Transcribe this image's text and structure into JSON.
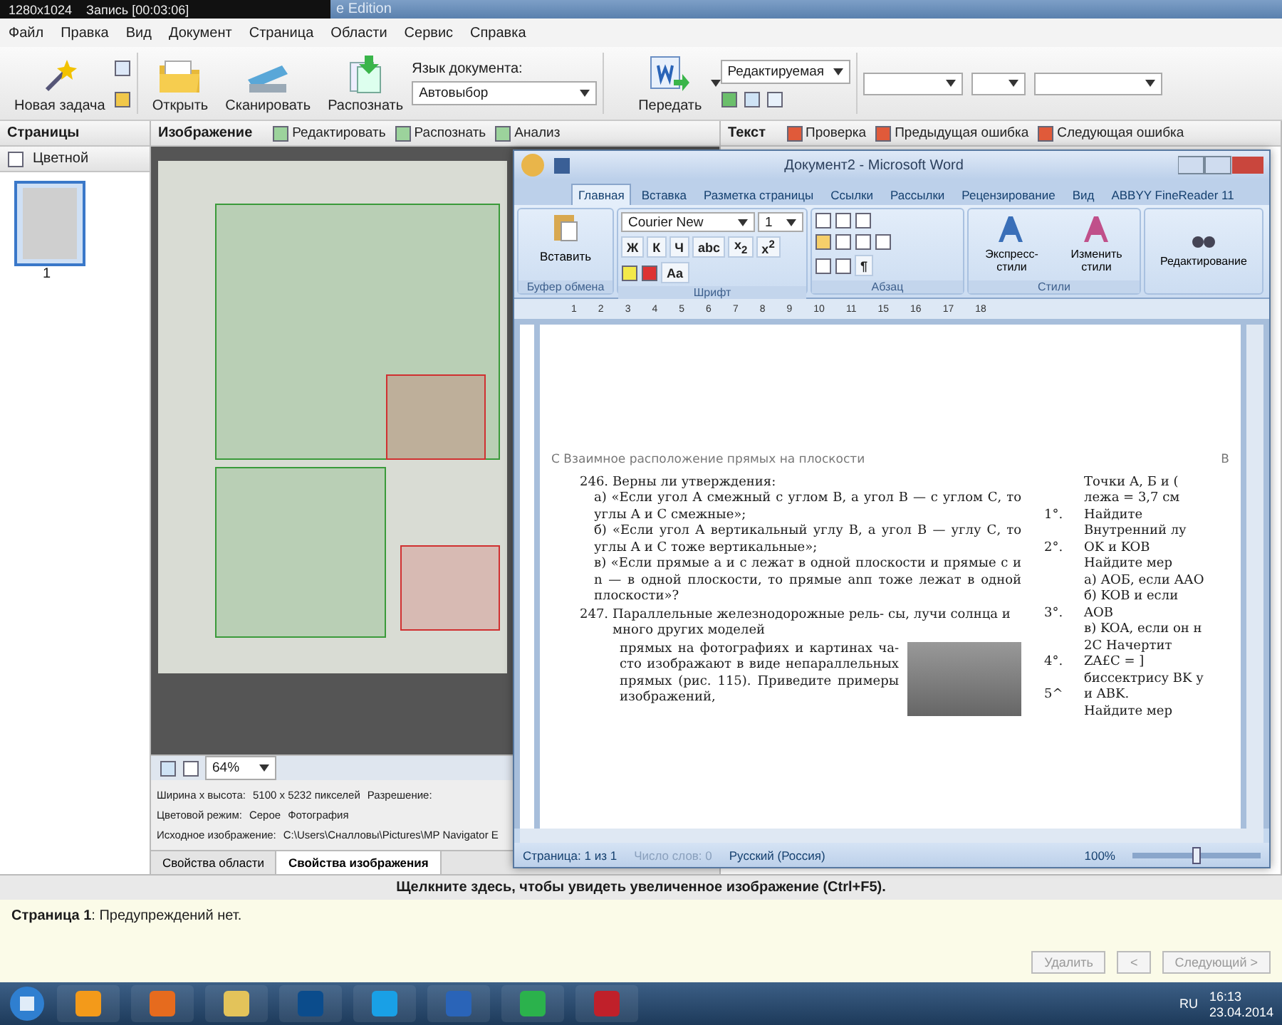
{
  "recorder": {
    "resolution": "1280x1024",
    "status": "Запись [00:03:06]"
  },
  "window": {
    "title": "e Edition"
  },
  "menu": [
    "Файл",
    "Правка",
    "Вид",
    "Документ",
    "Страница",
    "Области",
    "Сервис",
    "Справка"
  ],
  "toolbar": {
    "new_task": "Новая задача",
    "open": "Открыть",
    "scan": "Сканировать",
    "recognize": "Распознать",
    "language_label": "Язык документа:",
    "language": "Автовыбор",
    "send": "Передать",
    "mode": "Редактируемая"
  },
  "pages": {
    "title": "Страницы",
    "color_mode": "Цветной",
    "thumbnails": [
      {
        "number": "1",
        "selected": true
      }
    ]
  },
  "image": {
    "title": "Изображение",
    "actions": [
      "Редактировать",
      "Распознать",
      "Анализ"
    ],
    "zoom": "64%",
    "properties": [
      [
        "Ширина x высота:",
        "5100 x 5232 пикселей",
        "Разрешение:"
      ],
      [
        "Цветовой режим:",
        "Серое",
        "Фотография"
      ],
      [
        "Исходное изображение:",
        "C:\\Users\\Сналловы\\Pictures\\MP Navigator E"
      ]
    ],
    "tabs": [
      {
        "label": "Свойства области",
        "selected": false
      },
      {
        "label": "Свойства изображения",
        "selected": true
      }
    ]
  },
  "text_panel": {
    "title": "Текст",
    "actions": [
      "Проверка",
      "Предыдущая ошибка",
      "Следующая ошибка"
    ]
  },
  "word": {
    "title": "Документ2 - Microsoft Word",
    "tabs": [
      {
        "label": "Главная",
        "selected": true
      },
      {
        "label": "Вставка",
        "selected": false
      },
      {
        "label": "Разметка страницы",
        "selected": false
      },
      {
        "label": "Ссылки",
        "selected": false
      },
      {
        "label": "Рассылки",
        "selected": false
      },
      {
        "label": "Рецензирование",
        "selected": false
      },
      {
        "label": "Вид",
        "selected": false
      },
      {
        "label": "ABBYY FineReader 11",
        "selected": false
      }
    ],
    "paste": "Вставить",
    "font": "Courier New",
    "size": "1",
    "font_buttons": [
      "Ж",
      "К",
      "Ч",
      "abc",
      "x$_{2}$",
      "x$^{2}$"
    ],
    "case_button": "Aa",
    "pilcrow": "¶",
    "styles": [
      "Экспресс-стили",
      "Изменить стили"
    ],
    "editing": "Редактирование",
    "groups": [
      "Буфер обмена",
      "Шрифт",
      "Абзац",
      "Стили"
    ],
    "ruler": [
      "1",
      "2",
      "3",
      "4",
      "5",
      "6",
      "7",
      "8",
      "9",
      "10",
      "11",
      "15",
      "16",
      "17",
      "18"
    ],
    "document": {
      "header": "С Взаимное расположение прямых на плоскости",
      "header_right": "В",
      "exercises": [
        {
          "number": "246.",
          "text": "Верны ли утверждения:",
          "items": [
            "а) «Если угол А смежный с углом B, а угол B — с углом С, то углы А и С смежные»;",
            "б) «Если угол А вертикальный углу B, а угол B — углу С, то углы А и С тоже вертикальные»;",
            "в) «Если прямые a и c лежат в одной плоскости и прямые c и n — в одной плоскости, то прямые anп тоже лежат в одной плоскости»?"
          ]
        },
        {
          "number": "247.",
          "text": "Параллельные железнодорожные рель- сы, лучи солнца и много других моделей"
        }
      ],
      "figure_text": "прямых на фотографиях и картинах ча- сто изображают в виде непараллельных прямых (рис. 115). Приведите примеры изображений,",
      "side": [
        {
          "text": "Точки А, Б и ("
        },
        {
          "text": "лежа = 3,7 см"
        },
        {
          "number": "1°.",
          "text": "Найдите"
        },
        {
          "text": "Внутренний лу"
        },
        {
          "number": "2°.",
          "text": "OK и KOB"
        },
        {
          "text": "Найдите мер"
        },
        {
          "text": "а) АОБ, если ААО"
        },
        {
          "text": "б) KOB и если"
        },
        {
          "number": "3°.",
          "text": "AOB"
        },
        {
          "text": "в) KOA, если он н"
        },
        {
          "text": "2С Начертит"
        },
        {
          "number": "4°.",
          "text": "ZA£C = ]"
        },
        {
          "text": "биссектрису BK у"
        },
        {
          "number": "5^",
          "text": "и ABK."
        },
        {
          "text": "Найдите мер"
        }
      ]
    },
    "status": {
      "page": "Страница: 1 из 1",
      "words": "Число слов: 0",
      "language": "Русский (Россия)",
      "zoom": "100%",
      "zoom_slider": {
        "level": 0.5
      }
    }
  },
  "hint": "Щелкните здесь, чтобы увидеть увеличенное изображение (Ctrl+F5).",
  "warnings": {
    "message": "**Страница 1**: Предупреждений нет.",
    "buttons": [
      {
        "label": "Удалить",
        "disabled": true
      },
      {
        "label": "<",
        "disabled": true
      },
      {
        "label": "Следующий >",
        "disabled": true
      }
    ]
  },
  "taskbar": {
    "language": "RU",
    "time": "16:13",
    "date": "23.04.2014"
  }
}
